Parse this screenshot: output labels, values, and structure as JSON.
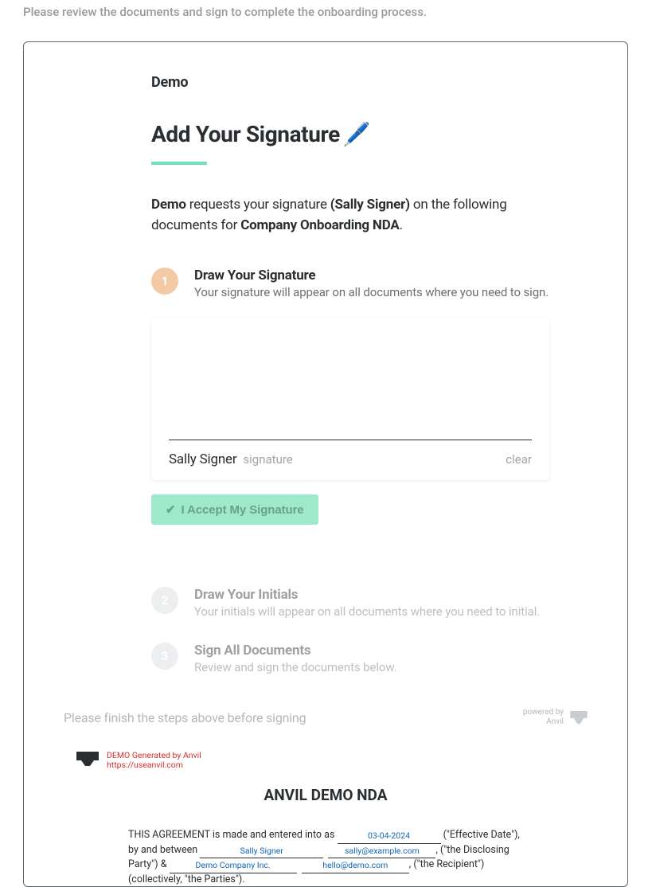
{
  "topInstruction": "Please review the documents and sign to complete the onboarding process.",
  "orgName": "Demo",
  "heading": "Add Your Signature",
  "penIcon": "🖊️",
  "intro": {
    "requester": "Demo",
    "midText1": " requests your signature ",
    "signerName": "(Sally Signer)",
    "midText2": " on the following documents for ",
    "packetName": "Company Onboarding NDA",
    "end": "."
  },
  "steps": {
    "one": {
      "num": "1",
      "title": "Draw Your Signature",
      "sub": "Your signature will appear on all documents where you need to sign."
    },
    "two": {
      "num": "2",
      "title": "Draw Your Initials",
      "sub": "Your initials will appear on all documents where you need to initial."
    },
    "three": {
      "num": "3",
      "title": "Sign All Documents",
      "sub": "Review and sign the documents below."
    }
  },
  "signature": {
    "signerName": "Sally Signer",
    "label": "signature",
    "clear": "clear"
  },
  "acceptButton": "I Accept My Signature",
  "finishText": "Please finish the steps above before signing",
  "poweredBy": {
    "line1": "powered by",
    "line2": "Anvil"
  },
  "docPreview": {
    "genLine1": "DEMO Generated by Anvil",
    "genLine2": "https://useanvil.com",
    "title": "ANVIL DEMO NDA",
    "body": {
      "t1": "THIS AGREEMENT is made and entered into as ",
      "date": "03-04-2024",
      "t2": " (\"Effective Date\"), by and between ",
      "name1": "Sally Signer",
      "email1": "sally@example.com",
      "t3": ", (\"the Disclosing Party\") & ",
      "name2": "Demo Company Inc.",
      "email2": "hello@demo.com",
      "t4": ", (\"the Recipient\") (collectively, \"the Parties\")."
    }
  }
}
